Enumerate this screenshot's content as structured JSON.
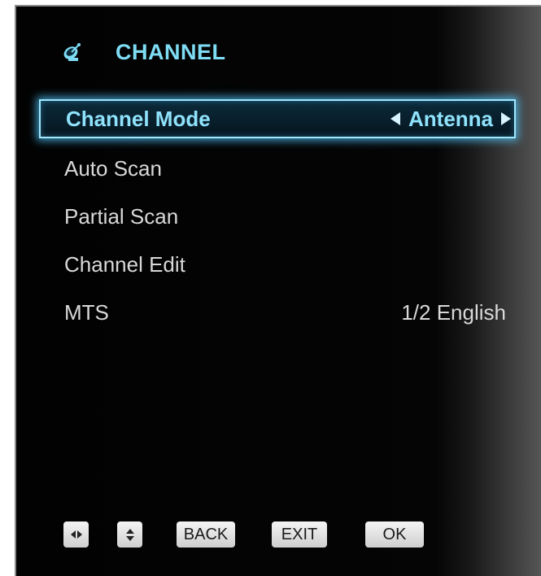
{
  "header": {
    "icon": "satellite-dish-icon",
    "title": "CHANNEL"
  },
  "menu": {
    "items": [
      {
        "label": "Channel Mode",
        "value": "Antenna",
        "selected": true
      },
      {
        "label": "Auto Scan",
        "value": ""
      },
      {
        "label": "Partial Scan",
        "value": ""
      },
      {
        "label": "Channel Edit",
        "value": ""
      },
      {
        "label": "MTS",
        "value": "1/2 English"
      }
    ]
  },
  "footer": {
    "left_right_icon": "left-right-arrows-icon",
    "up_down_icon": "up-down-arrows-icon",
    "back_label": "BACK",
    "exit_label": "EXIT",
    "ok_label": "OK"
  },
  "colors": {
    "accent": "#7fdcf5",
    "highlight_border": "#9fe8ff",
    "text": "#d8d8d8",
    "background": "#050505"
  }
}
